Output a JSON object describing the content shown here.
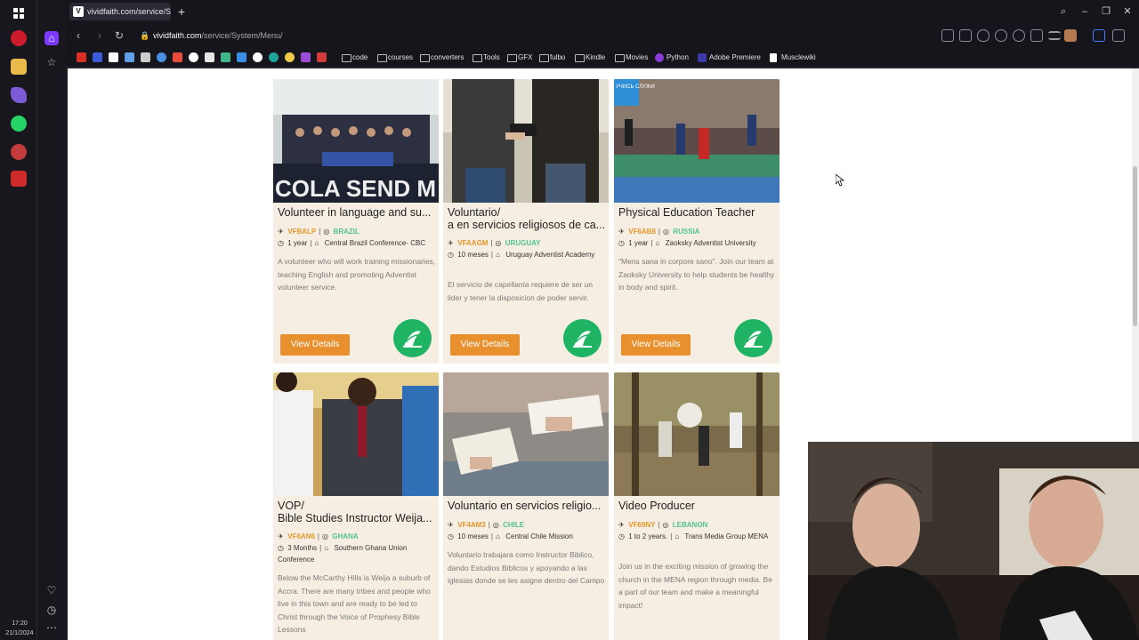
{
  "os": {
    "clock_time": "17:20",
    "clock_date": "21/1/2024"
  },
  "browser": {
    "tab_title": "vividfaith.com/service/Sys",
    "url_domain": "vividfaith.com",
    "url_path": "/service/System/Menu/",
    "bookmarks": [
      "code",
      "courses",
      "converters",
      "Tools",
      "GFX",
      "fulbo",
      "Kindle",
      "Movies",
      "Python",
      "Adobe Premiere",
      "Musclewiki"
    ]
  },
  "cards": [
    {
      "title": "Volunteer in language and su...",
      "code": "VFBALP",
      "country": "BRAZIL",
      "duration": "1 year",
      "org": "Central Brazil Conference- CBC",
      "description": "A volunteer who will work training missionaries, teaching English and promoting Adventist volunteer service.",
      "button": "View Details"
    },
    {
      "title": "Voluntario/\na en servicios religiosos de ca...",
      "code": "VFAAGM",
      "country": "URUGUAY",
      "duration": "10 meses",
      "org": "Uruguay Adventist Academy",
      "description": "El servicio de capellanía requiere de ser un lider y tener la disposicion de poder servir.",
      "button": "View Details"
    },
    {
      "title": "Physical Education Teacher",
      "code": "VF6AB8",
      "country": "RUSSIA",
      "duration": "1 year",
      "org": "Zaoksky Adventist University",
      "description": "\"Mens sana in corpore sano\". Join our team at Zaoksky University to help students be healthy in body and spirit.",
      "button": "View Details"
    },
    {
      "title": "VOP/\nBible Studies Instructor Weija...",
      "code": "VF6AN6",
      "country": "GHANA",
      "duration": "3 Months",
      "org": "Southern Ghana Union Conference",
      "description": "Below the McCarthy Hills is Weija a suburb of Accra. There are many tribes and people who live in this town and are ready to be led to Christ through the Voice of Prophesy Bible Lessons"
    },
    {
      "title": "Voluntario en servicios religio...",
      "code": "VF4AM3",
      "country": "CHILE",
      "duration": "10 meses",
      "org": "Central Chile Mission",
      "description": "Voluntario trabajara como Instructor Biblico, dando Estudios Biblicos y apoyando a las iglesias donde se les asigne dentro del Campo"
    },
    {
      "title": "Video Producer",
      "code": "VF69NY",
      "country": "LEBANON",
      "duration": "1 to 2 years.",
      "org": "Trans Media Group MENA",
      "description": "Join us in the exciting mission of growing the church in the MENA region through media. Be a part of our team and make a meaningful impact!"
    }
  ],
  "photo_text": {
    "card0_overlay": "COLA SEND M",
    "card2_overlay": "УЧИСЬ СЛУЖИ"
  }
}
